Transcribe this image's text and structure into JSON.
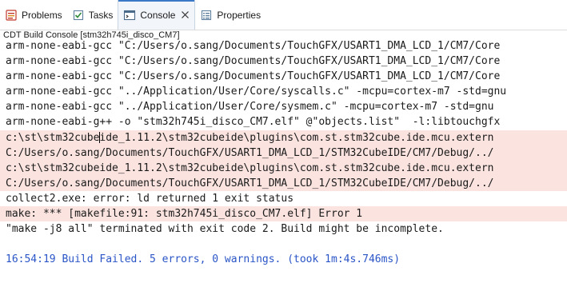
{
  "tabs": [
    {
      "label": "Problems",
      "icon": "problems-icon",
      "active": false
    },
    {
      "label": "Tasks",
      "icon": "tasks-icon",
      "active": false
    },
    {
      "label": "Console",
      "icon": "console-icon",
      "active": true
    },
    {
      "label": "Properties",
      "icon": "properties-icon",
      "active": false
    }
  ],
  "console_title": "CDT Build Console [stm32h745i_disco_CM7]",
  "lines": [
    {
      "text": "arm-none-eabi-gcc \"C:/Users/o.sang/Documents/TouchGFX/USART1_DMA_LCD_1/CM7/Core",
      "error": false
    },
    {
      "text": "arm-none-eabi-gcc \"C:/Users/o.sang/Documents/TouchGFX/USART1_DMA_LCD_1/CM7/Core",
      "error": false
    },
    {
      "text": "arm-none-eabi-gcc \"C:/Users/o.sang/Documents/TouchGFX/USART1_DMA_LCD_1/CM7/Core",
      "error": false
    },
    {
      "text": "arm-none-eabi-gcc \"../Application/User/Core/syscalls.c\" -mcpu=cortex-m7 -std=gnu",
      "error": false
    },
    {
      "text": "arm-none-eabi-gcc \"../Application/User/Core/sysmem.c\" -mcpu=cortex-m7 -std=gnu",
      "error": false
    },
    {
      "text": "arm-none-eabi-g++ -o \"stm32h745i_disco_CM7.elf\" @\"objects.list\"  -l:libtouchgfx",
      "error": false
    },
    {
      "text_before_caret": "c:\\st\\stm32cube",
      "text_after_caret": "ide_1.11.2\\stm32cubeide\\plugins\\com.st.stm32cube.ide.mcu.extern",
      "error": true
    },
    {
      "text": "C:/Users/o.sang/Documents/TouchGFX/USART1_DMA_LCD_1/STM32CubeIDE/CM7/Debug/../",
      "error": true
    },
    {
      "text": "c:\\st\\stm32cubeide_1.11.2\\stm32cubeide\\plugins\\com.st.stm32cube.ide.mcu.extern",
      "error": true
    },
    {
      "text": "C:/Users/o.sang/Documents/TouchGFX/USART1_DMA_LCD_1/STM32CubeIDE/CM7/Debug/../",
      "error": true
    },
    {
      "text": "collect2.exe: error: ld returned 1 exit status",
      "error": false
    },
    {
      "text": "make: *** [makefile:91: stm32h745i_disco_CM7.elf] Error 1",
      "error": true
    },
    {
      "text": "\"make -j8 all\" terminated with exit code 2. Build might be incomplete.",
      "error": false
    },
    {
      "text": "",
      "error": false
    },
    {
      "text": "16:54:19 Build Failed. 5 errors, 0 warnings. (took 1m:4s.746ms)",
      "error": false,
      "status": true
    }
  ],
  "colors": {
    "error_bg": "#fbe4e0",
    "status_text": "#2a55c7",
    "tab_accent": "#3c78c8"
  }
}
